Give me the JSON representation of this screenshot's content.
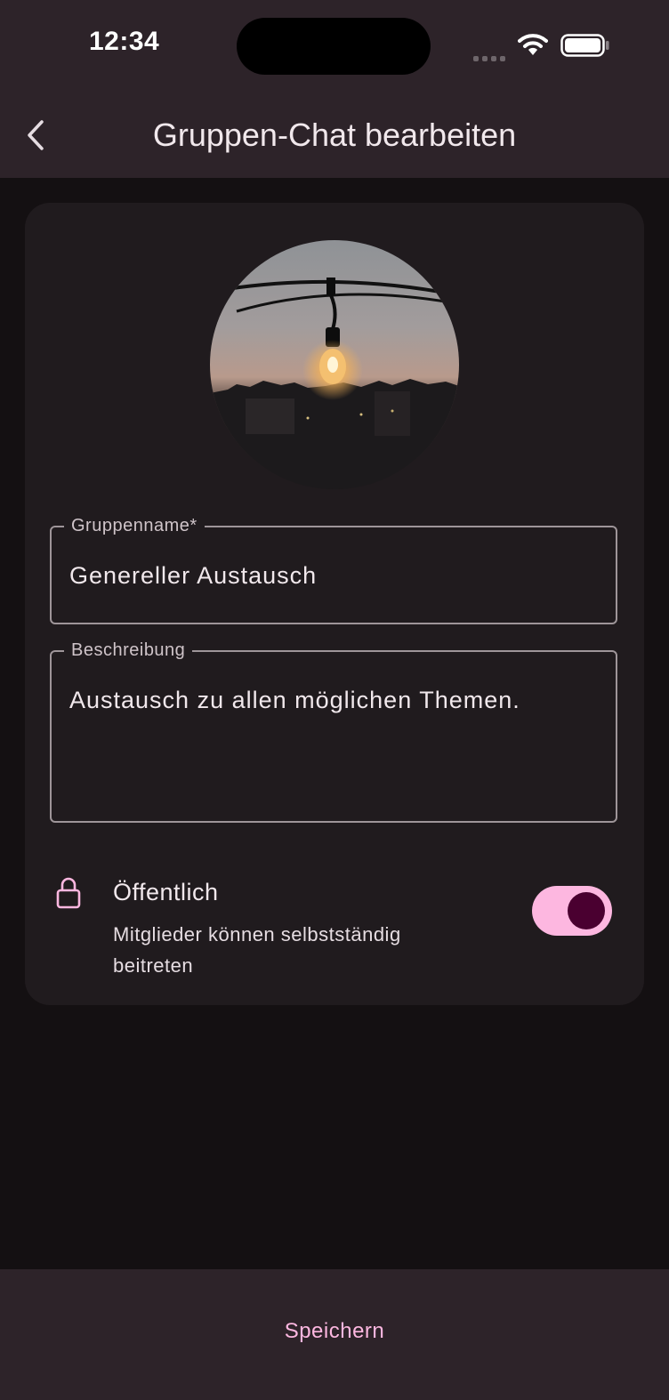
{
  "status_bar": {
    "time": "12:34",
    "icons": [
      "cellular-signal-icon",
      "wifi-icon",
      "battery-icon"
    ]
  },
  "app_bar": {
    "back_icon": "chevron-left-icon",
    "title": "Gruppen-Chat bearbeiten"
  },
  "form": {
    "avatar_image": "group-photo",
    "group_name": {
      "label": "Gruppenname*",
      "value": "Genereller Austausch"
    },
    "description": {
      "label": "Beschreibung",
      "value": "Austausch zu allen möglichen Themen."
    },
    "public_setting": {
      "icon": "lock-icon",
      "title": "Öffentlich",
      "subtitle": "Mitglieder können selbstständig beitreten",
      "enabled": true
    }
  },
  "footer": {
    "save_label": "Speichern"
  },
  "colors": {
    "accent": "#fdb7e0",
    "toggle_knob": "#4a0030",
    "bar_background": "#2d2329",
    "card_background": "#201b1e",
    "page_background": "#141012"
  }
}
